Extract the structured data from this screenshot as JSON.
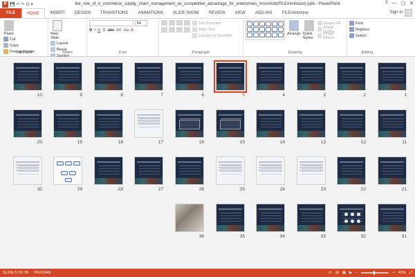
{
  "window": {
    "title": "the_role_of_e_commerce_supply_chain_management_as_competitive_advantage_for_enterprises_mnzvrksb(FILEminimizer).pptx - PowerPoint",
    "controls": [
      "?",
      "—",
      "▢",
      "✕"
    ]
  },
  "qat": {
    "logo": "P",
    "save": "💾",
    "undo": "↶",
    "redo": "↷",
    "start": "⊡",
    "more": "▾"
  },
  "tabs": [
    "FILE",
    "HOME",
    "INSERT",
    "DESIGN",
    "TRANSITIONS",
    "ANIMATIONS",
    "SLIDE SHOW",
    "REVIEW",
    "VIEW",
    "ADD-INS",
    "FILEminimizer"
  ],
  "active_tab": "HOME",
  "sign_in": "Sign in",
  "ribbon": {
    "clipboard": {
      "paste": "Paste",
      "cut": "Cut",
      "copy": "Copy",
      "format_painter": "Format Painter",
      "label": "Clipboard"
    },
    "slides": {
      "new_slide": "New Slide",
      "layout": "Layout",
      "reset": "Reset",
      "section": "Section",
      "label": "Slides"
    },
    "font": {
      "font_name": "",
      "font_size": "54",
      "label": "Font",
      "buttons": [
        "B",
        "I",
        "U",
        "S",
        "abc",
        "AV",
        "Aa",
        "A"
      ]
    },
    "paragraph": {
      "text_direction": "Text Direction",
      "align_text": "Align Text",
      "convert_smartart": "Convert to SmartArt",
      "label": "Paragraph"
    },
    "drawing": {
      "arrange": "Arrange",
      "quick_styles": "Quick Styles",
      "shape_fill": "Shape Fill",
      "shape_outline": "Shape Outline",
      "shape_effects": "Shape Effects",
      "label": "Drawing"
    },
    "editing": {
      "find": "Find",
      "replace": "Replace",
      "select": "Select",
      "label": "Editing"
    }
  },
  "slides": [
    {
      "n": "1",
      "style": "dark"
    },
    {
      "n": "2",
      "style": "dark"
    },
    {
      "n": "3",
      "style": "dark"
    },
    {
      "n": "4",
      "style": "dark"
    },
    {
      "n": "5",
      "style": "dark",
      "selected": true
    },
    {
      "n": "6",
      "style": "dark"
    },
    {
      "n": "7",
      "style": "dark"
    },
    {
      "n": "8",
      "style": "dark"
    },
    {
      "n": "9",
      "style": "dark"
    },
    {
      "n": "10",
      "style": "dark"
    },
    {
      "n": "11",
      "style": "dark"
    },
    {
      "n": "12",
      "style": "dark"
    },
    {
      "n": "13",
      "style": "dark"
    },
    {
      "n": "14",
      "style": "dark"
    },
    {
      "n": "15",
      "style": "table"
    },
    {
      "n": "16",
      "style": "table"
    },
    {
      "n": "17",
      "style": "light"
    },
    {
      "n": "18",
      "style": "dark"
    },
    {
      "n": "19",
      "style": "dark"
    },
    {
      "n": "20",
      "style": "dark"
    },
    {
      "n": "21",
      "style": "dark"
    },
    {
      "n": "22",
      "style": "dark"
    },
    {
      "n": "23",
      "style": "light"
    },
    {
      "n": "24",
      "style": "light"
    },
    {
      "n": "25",
      "style": "light"
    },
    {
      "n": "26",
      "style": "dark"
    },
    {
      "n": "27",
      "style": "dark"
    },
    {
      "n": "28",
      "style": "dark"
    },
    {
      "n": "29",
      "style": "diagram"
    },
    {
      "n": "30",
      "style": "light"
    },
    {
      "n": "31",
      "style": "dark"
    },
    {
      "n": "32",
      "style": "dots"
    },
    {
      "n": "33",
      "style": "dark"
    },
    {
      "n": "34",
      "style": "dark"
    },
    {
      "n": "35",
      "style": "dark"
    },
    {
      "n": "36",
      "style": "photo"
    }
  ],
  "status": {
    "slide_info": "SLIDE 5 OF 36",
    "language": "PERSIAN",
    "zoom": "40%"
  },
  "colors": {
    "accent": "#d24726",
    "slide_bg": "#1d2b44",
    "sorter_bg": "#f3f3f3"
  }
}
